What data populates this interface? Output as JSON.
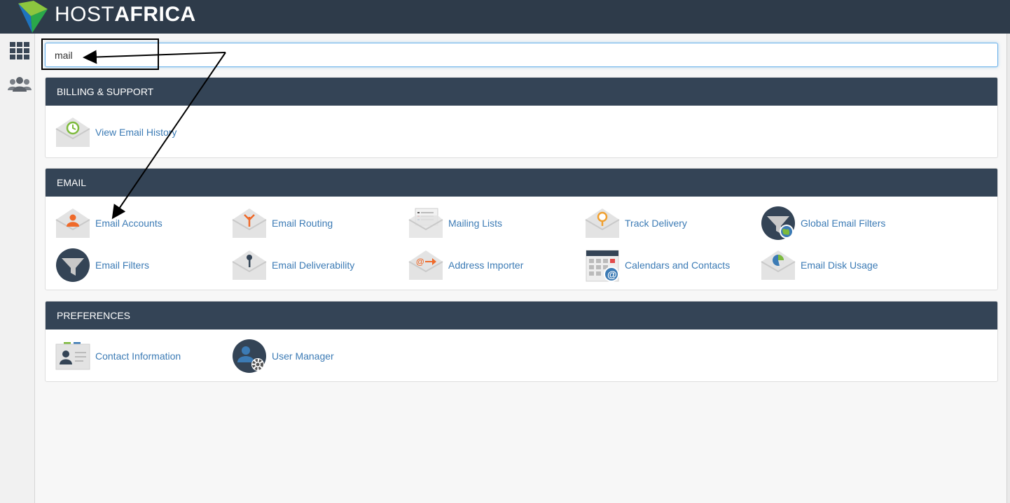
{
  "brand": {
    "name_light": "HOST",
    "name_bold": "AFRICA"
  },
  "colors": {
    "header": "#2e3b4a",
    "panel_header": "#344456",
    "link": "#3c7bb5",
    "accent_orange": "#ef6a2a",
    "accent_green": "#7dba3c"
  },
  "rail": {
    "items": [
      {
        "icon": "grid-icon"
      },
      {
        "icon": "users-icon"
      }
    ]
  },
  "search": {
    "value": "mail"
  },
  "sections": {
    "billing": {
      "title": "BILLING & SUPPORT",
      "items": [
        {
          "label": "View Email History",
          "icon": "envelope-history-icon"
        }
      ]
    },
    "email": {
      "title": "EMAIL",
      "items": [
        {
          "label": "Email Accounts",
          "icon": "envelope-user-icon"
        },
        {
          "label": "Email Routing",
          "icon": "envelope-routing-icon"
        },
        {
          "label": "Mailing Lists",
          "icon": "mailing-list-icon"
        },
        {
          "label": "Track Delivery",
          "icon": "envelope-track-icon"
        },
        {
          "label": "Global Email Filters",
          "icon": "global-filter-icon"
        },
        {
          "label": "Email Filters",
          "icon": "filter-icon"
        },
        {
          "label": "Email Deliverability",
          "icon": "envelope-key-icon"
        },
        {
          "label": "Address Importer",
          "icon": "envelope-import-icon"
        },
        {
          "label": "Calendars and Contacts",
          "icon": "calendar-icon"
        },
        {
          "label": "Email Disk Usage",
          "icon": "envelope-pie-icon"
        }
      ]
    },
    "preferences": {
      "title": "PREFERENCES",
      "items": [
        {
          "label": "Contact Information",
          "icon": "contact-card-icon"
        },
        {
          "label": "User Manager",
          "icon": "user-manager-icon"
        }
      ]
    }
  }
}
